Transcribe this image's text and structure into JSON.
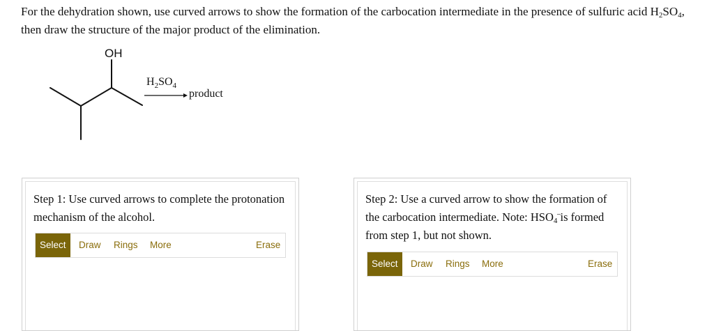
{
  "question": {
    "part1": "For the dehydration shown, use curved arrows to show the formation of the carbocation intermediate in the presence of sulfuric acid H",
    "sub1": "2",
    "part2": "SO",
    "sub2": "4",
    "part3": ", then draw the structure of the major product of the elimination."
  },
  "reaction": {
    "oh_label": "OH",
    "reagent_h": "H",
    "reagent_sub1": "2",
    "reagent_so": "SO",
    "reagent_sub2": "4",
    "product_label": "product"
  },
  "step1": {
    "text": "Step 1: Use curved arrows to complete the protonation mechanism of the alcohol.",
    "toolbar": {
      "select": "Select",
      "draw": "Draw",
      "rings": "Rings",
      "more": "More",
      "erase": "Erase"
    }
  },
  "step2": {
    "text_a": "Step 2: Use a curved arrow to show the formation of the carbocation intermediate. Note: HSO",
    "sub": "4",
    "sup": "−",
    "text_b": " is formed from step 1, but not shown.",
    "toolbar": {
      "select": "Select",
      "draw": "Draw",
      "rings": "Rings",
      "more": "More",
      "erase": "Erase"
    }
  },
  "colors": {
    "accent": "#7a6509",
    "tool_text": "#8a6d0b",
    "border": "#cfcfcf"
  }
}
